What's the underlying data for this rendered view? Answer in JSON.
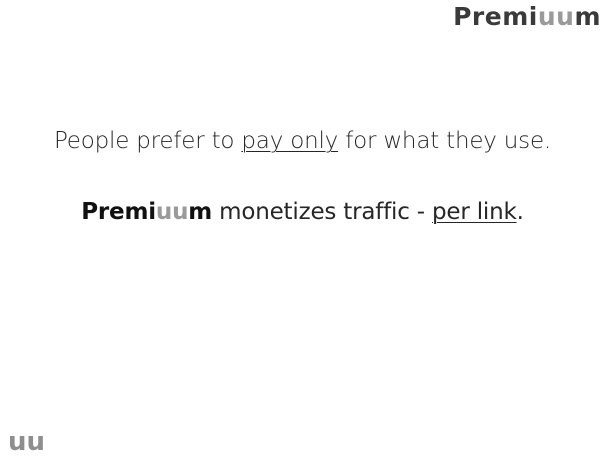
{
  "brand": {
    "part1": "Premi",
    "accent": "uu",
    "part2": "m"
  },
  "line1": {
    "before": "People prefer to ",
    "underlined": "pay only",
    "after": " for what they use."
  },
  "line2": {
    "middle": " monetizes traffic - ",
    "underlined": "per link",
    "after": "."
  },
  "footer": {
    "mark": "uu"
  },
  "colors": {
    "text": "#262626",
    "brand_dark": "#111111",
    "brand_accent": "#9a9a9a"
  }
}
